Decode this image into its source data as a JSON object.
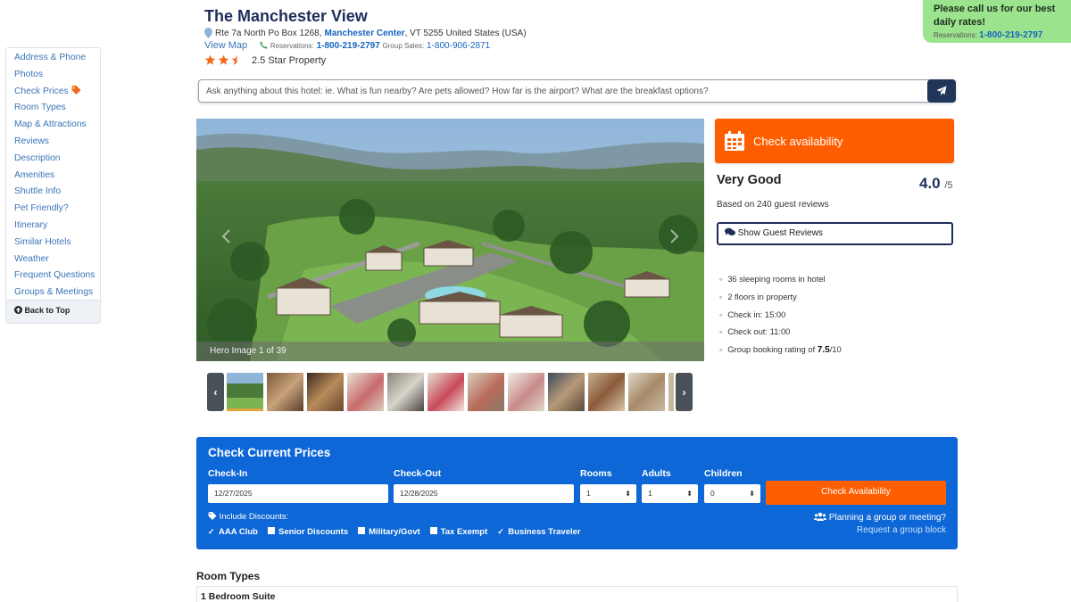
{
  "header": {
    "title": "The Manchester View",
    "address_prefix": "Rte 7a North Po Box 1268,",
    "address_city": "Manchester Center",
    "address_suffix": ", VT 5255 United States (USA)",
    "view_map": "View Map",
    "reservations_label": "Reservations:",
    "reservations_phone": "1-800-219-2797",
    "group_sales_label": "Group Sales:",
    "group_sales_phone": "1-800-906-2871",
    "stars_text": "2.5 Star Property",
    "star_rating": 2.5,
    "star_color": "#f26b1d"
  },
  "call_banner": {
    "message": "Please call us for our best daily rates!",
    "reservations_label": "Reservations:",
    "phone": "1-800-219-2797",
    "background": "#9be38c"
  },
  "sidebar": {
    "items": [
      {
        "label": "Address & Phone"
      },
      {
        "label": "Photos"
      },
      {
        "label": "Check Prices",
        "icon": "tag-icon"
      },
      {
        "label": "Room Types"
      },
      {
        "label": "Map & Attractions"
      },
      {
        "label": "Reviews"
      },
      {
        "label": "Description"
      },
      {
        "label": "Amenities"
      },
      {
        "label": "Shuttle Info"
      },
      {
        "label": "Pet Friendly?"
      },
      {
        "label": "Itinerary"
      },
      {
        "label": "Similar Hotels"
      },
      {
        "label": "Weather"
      },
      {
        "label": "Frequent Questions"
      },
      {
        "label": "Groups & Meetings"
      }
    ],
    "back_to_top": "Back to Top"
  },
  "ask": {
    "placeholder": "Ask anything about this hotel: ie. What is fun nearby? Are pets allowed? How far is the airport? What are the breakfast options?",
    "send_icon": "paper-plane-icon"
  },
  "hero": {
    "caption": "Hero Image 1 of 39"
  },
  "thumbnails": {
    "prev": "‹",
    "next": "›",
    "count_visible": 12
  },
  "summary": {
    "check_availability": "Check availability",
    "rating_label": "Very Good",
    "rating_value": "4.0",
    "rating_max": "/5",
    "based_on": "Based on 240 guest reviews",
    "show_reviews": "Show Guest Reviews",
    "facts": [
      {
        "text": "36 sleeping rooms in hotel"
      },
      {
        "text": "2 floors in property"
      },
      {
        "text": "Check in: 15:00"
      },
      {
        "text": "Check out: 11:00"
      },
      {
        "text_before": "Group booking rating of ",
        "bold": "7.5",
        "text_after": "/10"
      }
    ],
    "accent": "#ff5e00"
  },
  "booking": {
    "title": "Check Current Prices",
    "check_in_label": "Check-In",
    "check_in_value": "12/27/2025",
    "check_out_label": "Check-Out",
    "check_out_value": "12/28/2025",
    "rooms_label": "Rooms",
    "rooms_value": "1",
    "adults_label": "Adults",
    "adults_value": "1",
    "children_label": "Children",
    "children_value": "0",
    "button": "Check Availability",
    "discounts_title": "Include Discounts:",
    "discounts": [
      {
        "label": "AAA Club",
        "checked": true
      },
      {
        "label": "Senior Discounts",
        "checked": false
      },
      {
        "label": "Military/Govt",
        "checked": false
      },
      {
        "label": "Tax Exempt",
        "checked": false
      },
      {
        "label": "Business Traveler",
        "checked": true
      }
    ],
    "group_question": "Planning a group or meeting?",
    "group_link": "Request a group block",
    "background": "#0e67d6"
  },
  "rooms": {
    "heading": "Room Types",
    "first_room": "1 Bedroom Suite"
  }
}
